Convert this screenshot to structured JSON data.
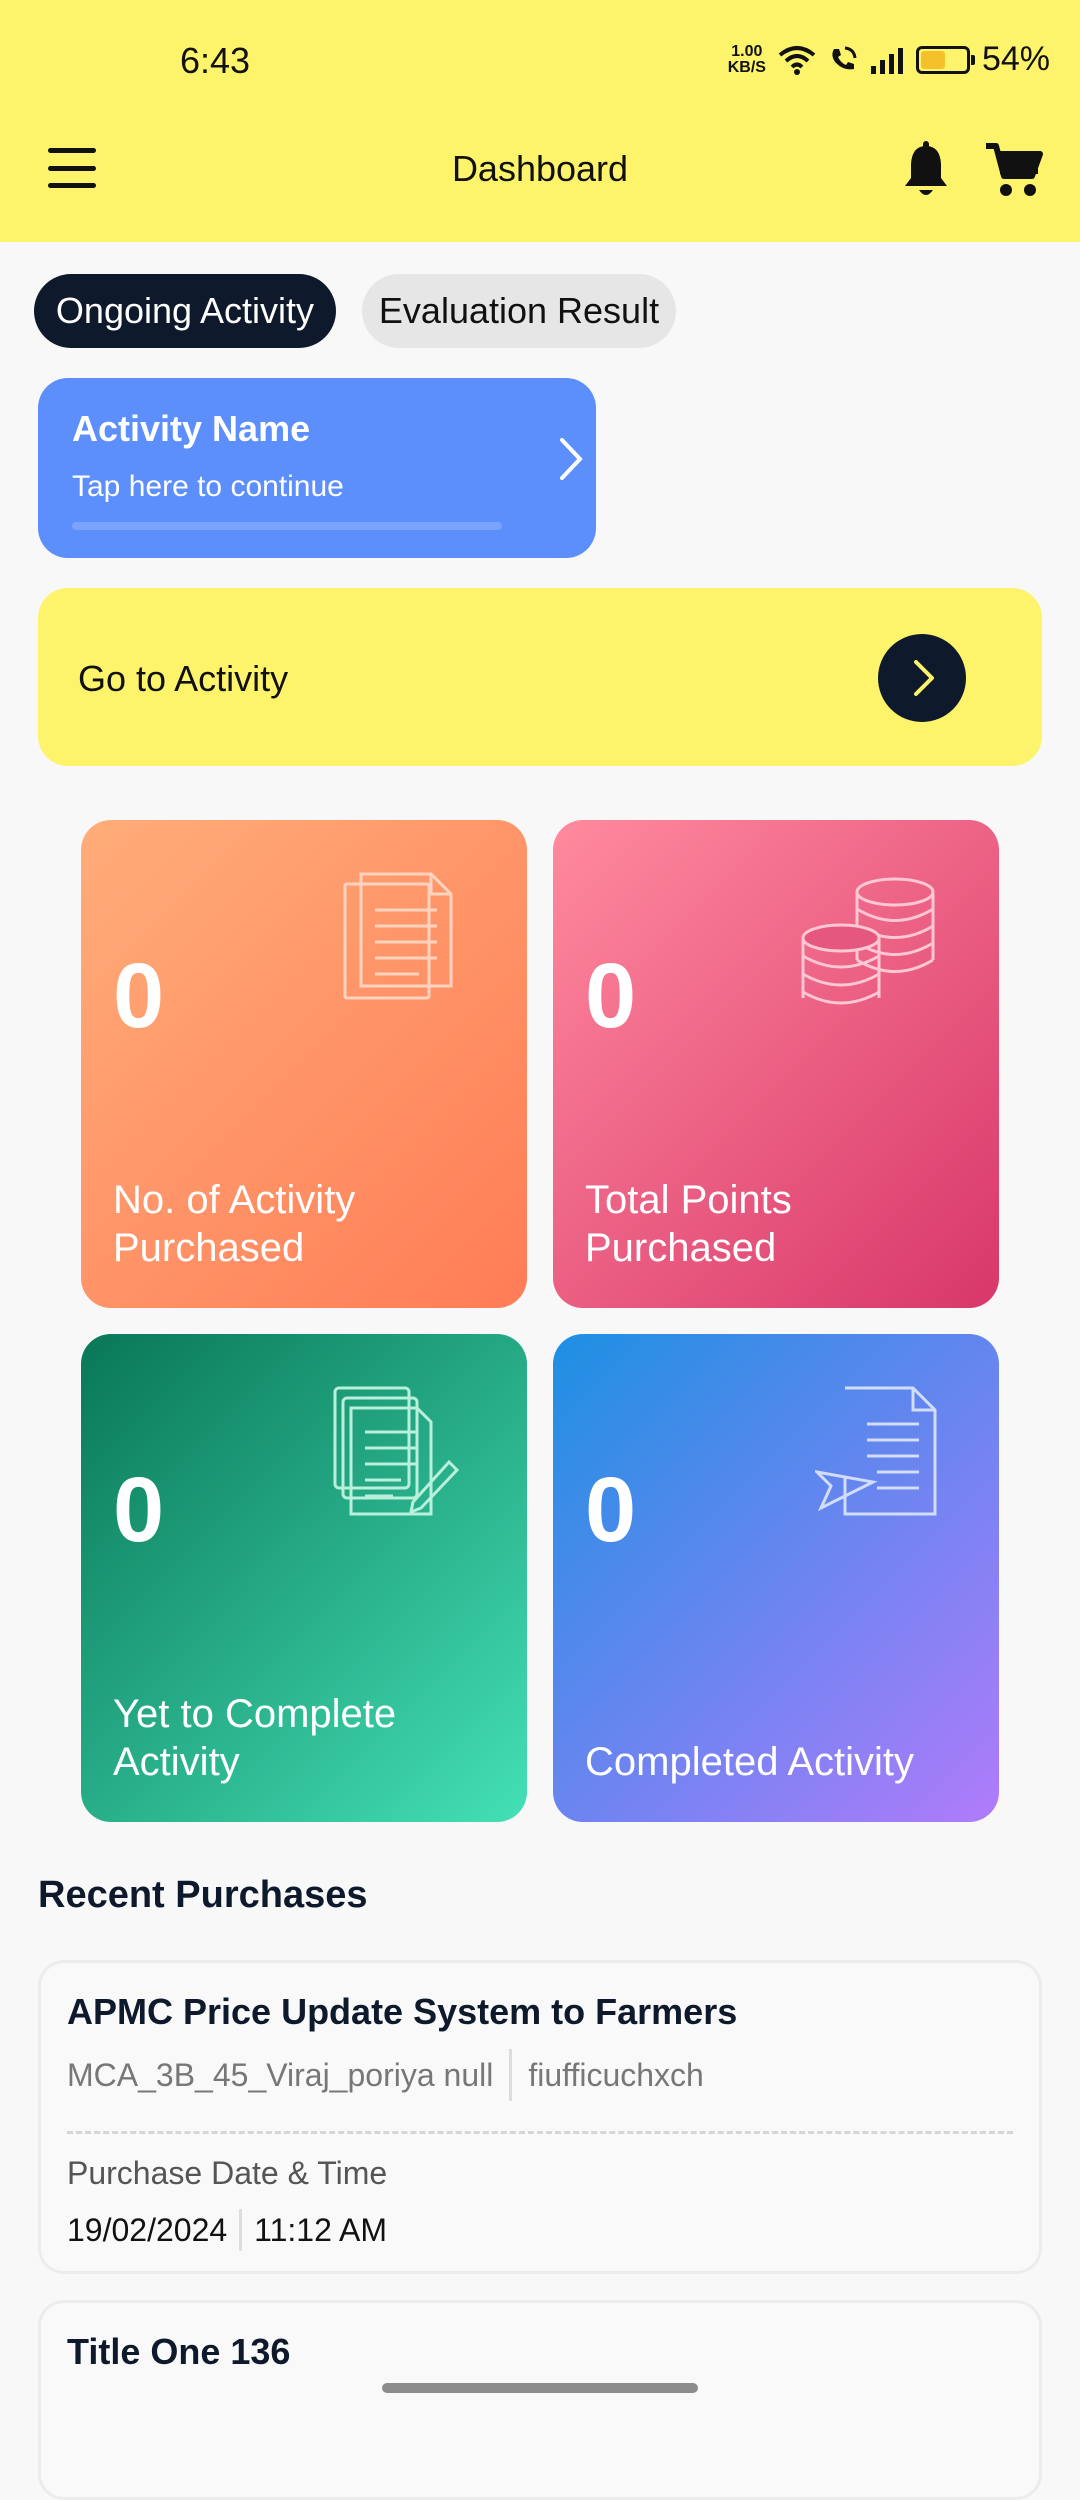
{
  "status_bar": {
    "time": "6:43",
    "net_speed_value": "1.00",
    "net_speed_unit": "KB/S",
    "battery": "54%",
    "battery_level": 0.54,
    "icons": [
      "wifi-icon",
      "wifi-call-icon",
      "signal-icon",
      "battery-icon"
    ]
  },
  "header": {
    "title": "Dashboard",
    "background": "#fdf46b",
    "icons": [
      "menu-icon",
      "bell-icon",
      "cart-icon"
    ]
  },
  "tabs": [
    {
      "label": "Ongoing Activity",
      "active": true
    },
    {
      "label": "Evaluation Result",
      "active": false
    }
  ],
  "activity_card": {
    "name": "Activity Name",
    "hint": "Tap here to continue",
    "color": "#5c8ffb"
  },
  "go_activity": {
    "label": "Go to Activity"
  },
  "stats": [
    {
      "value": "0",
      "label": "No. of Activity Purchased",
      "icon": "document-icon"
    },
    {
      "value": "0",
      "label": "Total Points Purchased",
      "icon": "coins-icon"
    },
    {
      "value": "0",
      "label": "Yet to Complete Activity",
      "icon": "document-edit-icon"
    },
    {
      "value": "0",
      "label": "Completed Activity",
      "icon": "document-sent-icon"
    }
  ],
  "recent_purchases": {
    "title": "Recent Purchases",
    "items": [
      {
        "title": "APMC Price Update System to Farmers",
        "owner": "MCA_3B_45_Viraj_poriya null",
        "code": "fiufficuchxch",
        "date_label": "Purchase Date & Time",
        "date": "19/02/2024",
        "time": "11:12 AM"
      },
      {
        "title": "Title One 136"
      }
    ]
  }
}
